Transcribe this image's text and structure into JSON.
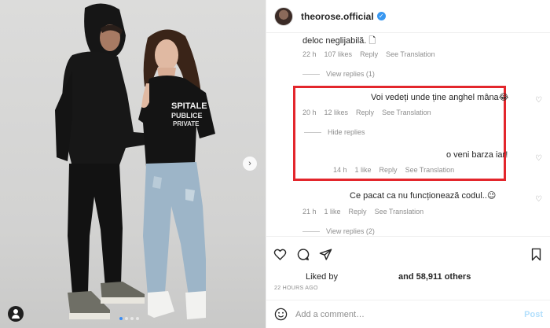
{
  "post": {
    "username": "theorose.official",
    "verified_glyph": "✓"
  },
  "comments": [
    {
      "text": "deloc neglijabilă. 🗋",
      "time": "22 h",
      "likes": "107 likes",
      "reply": "Reply",
      "translate": "See Translation",
      "view_replies": "View replies (1)"
    },
    {
      "text": "Voi vedeți unde ține anghel mâna😂",
      "time": "20 h",
      "likes": "12 likes",
      "reply": "Reply",
      "translate": "See Translation",
      "hide_replies": "Hide replies",
      "reply_item": {
        "text": "o veni barza iar!",
        "time": "14 h",
        "likes": "1 like",
        "reply": "Reply",
        "translate": "See Translation"
      }
    },
    {
      "text": "Ce pacat ca nu funcționează codul..😉",
      "time": "21 h",
      "likes": "1 like",
      "reply": "Reply",
      "translate": "See Translation",
      "view_replies": "View replies (2)"
    }
  ],
  "likes_section": {
    "liked_by": "Liked by",
    "others": "and 58,911 others",
    "timestamp": "22 HOURS AGO"
  },
  "add_comment": {
    "placeholder": "Add a comment…",
    "post_label": "Post"
  },
  "icons": {
    "heart": "heart-icon",
    "comment": "comment-icon",
    "share": "share-icon",
    "save": "bookmark-icon",
    "emoji": "emoji-icon",
    "tag": "user-tag-icon"
  },
  "colors": {
    "highlight": "#e3262c",
    "link_blue": "#3897f0",
    "muted": "#8e8e8e"
  }
}
